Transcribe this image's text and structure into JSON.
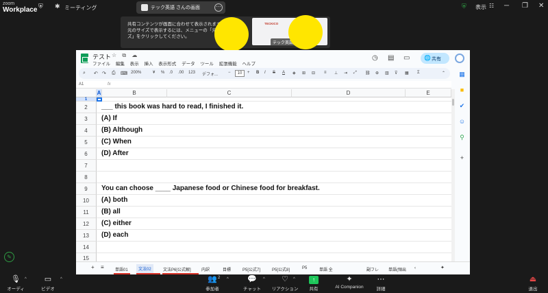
{
  "zoom": {
    "logo_line1": "zoom",
    "logo_line2": "Workplace",
    "meeting_label": "ミーティング",
    "share_chip": "テック英語 さんの画面",
    "view_label": "表示"
  },
  "popup": {
    "line1": "共有コンテンツが画面に合わせて表示されます",
    "line2": "元のサイズで表示するには、メニューの「元のサイ",
    "line3": "ズ」をクリックしてください。",
    "thumb_brand": "TECKICO",
    "thumb_name": "テック英語"
  },
  "sheets": {
    "title": "テスト",
    "menu": [
      "ファイル",
      "編集",
      "表示",
      "挿入",
      "表示形式",
      "データ",
      "ツール",
      "拡張機能",
      "ヘルプ"
    ],
    "share_label": "共有",
    "toolbar": {
      "zoom": "200%",
      "currency": "¥",
      "percent": "%",
      "dec1": ".0",
      "dec2": ".00",
      "num": "123",
      "font": "デフォ...",
      "font_size": "10",
      "bold": "B",
      "italic": "I"
    },
    "cell_ref": "A1",
    "fx": "fx",
    "columns": [
      "A",
      "B",
      "C",
      "D",
      "E"
    ],
    "rows": [
      {
        "num": "1",
        "text": ""
      },
      {
        "num": "2",
        "text": "___ this book was hard to read, I finished it."
      },
      {
        "num": "3",
        "text": "(A) If"
      },
      {
        "num": "4",
        "text": "(B) Although"
      },
      {
        "num": "5",
        "text": "(C) When"
      },
      {
        "num": "6",
        "text": "(D) After"
      },
      {
        "num": "7",
        "text": ""
      },
      {
        "num": "8",
        "text": ""
      },
      {
        "num": "9",
        "text": "You can choose ____ Japanese food or Chinese food for breakfast."
      },
      {
        "num": "10",
        "text": "(A) both"
      },
      {
        "num": "11",
        "text": "(B) all"
      },
      {
        "num": "12",
        "text": "(C) either"
      },
      {
        "num": "13",
        "text": "(D) each"
      },
      {
        "num": "14",
        "text": ""
      },
      {
        "num": "15",
        "text": ""
      }
    ],
    "tabs": [
      "単語01",
      "文法02",
      "文法P6[公式解]",
      "内訳",
      "目標",
      "P5[公式7]",
      "P5[公式8]",
      "P5",
      "単語 全",
      "副フレ",
      "単語(頻出"
    ],
    "active_tab": "文法02"
  },
  "bottom": {
    "audio": "オーディオ",
    "video": "ビデオ",
    "participants": "参加者",
    "participants_count": "2",
    "chat": "チャット",
    "reactions": "リアクション",
    "share": "共有",
    "ai": "AI Companion",
    "more": "詳細",
    "leave": "退出"
  },
  "colors": {
    "zoom_bg": "#1a1a1a",
    "share_green": "#1ec65a",
    "sheets_green": "#0f9d58",
    "selection_blue": "#1a73e8",
    "share_button": "#c2e7ff",
    "highlight_yellow": "#ffe600"
  }
}
